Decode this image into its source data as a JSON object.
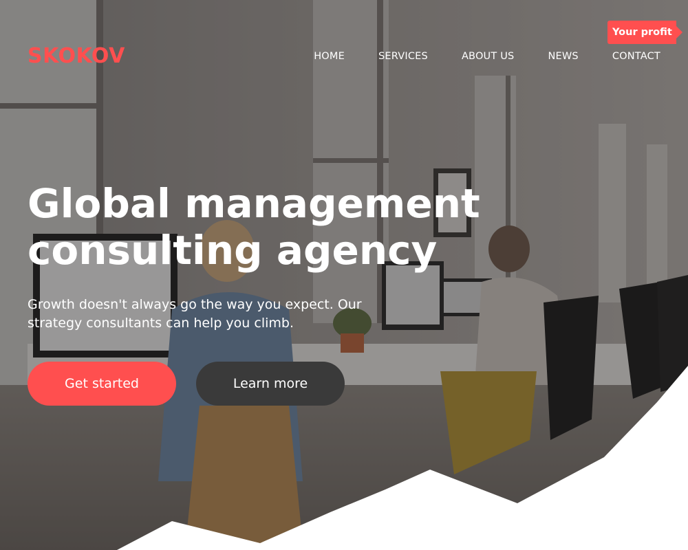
{
  "brand": {
    "logo": "SKOKOV",
    "accent_color": "#ff4f4f"
  },
  "nav": {
    "items": [
      {
        "label": "HOME"
      },
      {
        "label": "SERVICES"
      },
      {
        "label": "ABOUT US"
      },
      {
        "label": "NEWS"
      },
      {
        "label": "CONTACT"
      }
    ]
  },
  "badge": {
    "label": "Your profit"
  },
  "hero": {
    "headline_line1": "Global management",
    "headline_line2": "consulting agency",
    "subtitle_line1": "Growth doesn't always go the way you expect. Our",
    "subtitle_line2": "strategy consultants can help you climb.",
    "primary_button": "Get started",
    "secondary_button": "Learn more",
    "secondary_button_color": "#3a3a3a"
  }
}
